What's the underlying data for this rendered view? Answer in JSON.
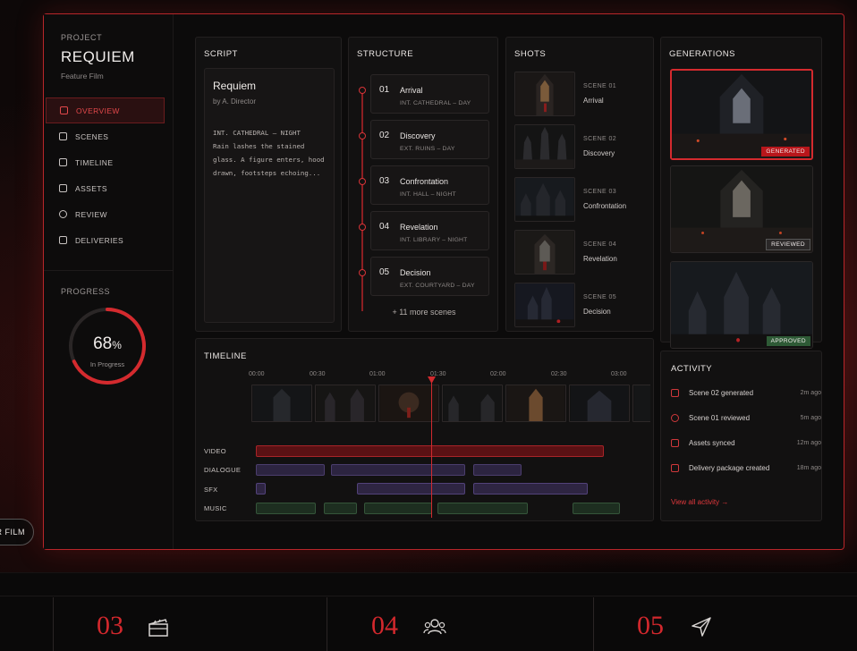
{
  "left_pill": "R FILM",
  "project": {
    "label": "PROJECT",
    "title": "REQUIEM",
    "subtitle": "Feature Film"
  },
  "nav": [
    {
      "label": "OVERVIEW",
      "icon": "overview-icon",
      "active": true
    },
    {
      "label": "SCENES",
      "icon": "scenes-icon",
      "active": false
    },
    {
      "label": "TIMELINE",
      "icon": "timeline-icon",
      "active": false
    },
    {
      "label": "ASSETS",
      "icon": "assets-icon",
      "active": false
    },
    {
      "label": "REVIEW",
      "icon": "review-icon",
      "active": false
    },
    {
      "label": "DELIVERIES",
      "icon": "deliveries-icon",
      "active": false
    }
  ],
  "progress": {
    "label": "PROGRESS",
    "value": "68",
    "unit": "%",
    "caption": "In Progress",
    "fraction": 0.68
  },
  "script": {
    "heading": "SCRIPT",
    "title": "Requiem",
    "author": "by A. Director",
    "body": "INT. CATHEDRAL – NIGHT\nRain lashes the stained glass. A figure enters, hood drawn, footsteps echoing..."
  },
  "structure": {
    "heading": "STRUCTURE",
    "scenes": [
      {
        "num": "01",
        "name": "Arrival",
        "location": "INT. CATHEDRAL – DAY"
      },
      {
        "num": "02",
        "name": "Discovery",
        "location": "EXT. RUINS – DAY"
      },
      {
        "num": "03",
        "name": "Confrontation",
        "location": "INT. HALL – NIGHT"
      },
      {
        "num": "04",
        "name": "Revelation",
        "location": "INT. LIBRARY – NIGHT"
      },
      {
        "num": "05",
        "name": "Decision",
        "location": "EXT. COURTYARD – DAY"
      }
    ],
    "more": "+ 11 more scenes"
  },
  "shots": {
    "heading": "SHOTS",
    "items": [
      {
        "scene": "SCENE 01",
        "name": "Arrival"
      },
      {
        "scene": "SCENE 02",
        "name": "Discovery"
      },
      {
        "scene": "SCENE 03",
        "name": "Confrontation"
      },
      {
        "scene": "SCENE 04",
        "name": "Revelation"
      },
      {
        "scene": "SCENE 05",
        "name": "Decision"
      }
    ]
  },
  "generations": {
    "heading": "GENERATIONS",
    "items": [
      {
        "badge": "GENERATED",
        "badge_color": "#b8161b"
      },
      {
        "badge": "REVIEWED",
        "badge_color": "#2b2828"
      },
      {
        "badge": "APPROVED",
        "badge_color": "#2e5a36"
      }
    ]
  },
  "timeline": {
    "heading": "TIMELINE",
    "ticks": [
      "00:00",
      "00:30",
      "01:00",
      "01:30",
      "02:00",
      "02:30",
      "03:00"
    ],
    "tracks": [
      "VIDEO",
      "DIALOGUE",
      "SFX",
      "MUSIC"
    ]
  },
  "activity": {
    "heading": "ACTIVITY",
    "items": [
      {
        "text": "Scene 02 generated",
        "time": "2m ago"
      },
      {
        "text": "Scene 01 reviewed",
        "time": "5m ago"
      },
      {
        "text": "Assets synced",
        "time": "12m ago"
      },
      {
        "text": "Delivery package created",
        "time": "18m ago"
      }
    ],
    "link": "View all activity →"
  },
  "bottom": [
    {
      "num": "03",
      "icon": "clapperboard-icon"
    },
    {
      "num": "04",
      "icon": "users-icon"
    },
    {
      "num": "05",
      "icon": "send-icon"
    }
  ],
  "colors": {
    "accent": "#d42a2e",
    "panel": "#121111",
    "approved": "#2e5a36"
  }
}
